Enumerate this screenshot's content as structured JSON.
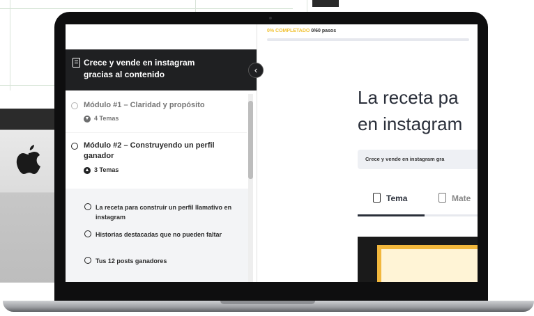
{
  "course": {
    "title": "Crece y vende en instagram gracias al contenido"
  },
  "progress": {
    "percent_label": "0% COMPLETADO",
    "steps_label": "0/60 pasos",
    "value": 0
  },
  "modules": [
    {
      "title": "Módulo #1 – Claridad y propósito",
      "topics": "4 Temas"
    },
    {
      "title": "Módulo #2 – Construyendo un perfil ganador",
      "topics": "3 Temas"
    }
  ],
  "lessons": [
    {
      "title": "La receta para construir un perfil llamativo en instagram"
    },
    {
      "title": "Historias destacadas que no pueden faltar"
    },
    {
      "title": "Tus 12 posts ganadores"
    }
  ],
  "main": {
    "heading_line1": "La receta pa",
    "heading_line2": "en instagram",
    "breadcrumb": "Crece y vende en instagram gra",
    "tab_topic": "Tema",
    "tab_materials": "Mate"
  },
  "colors": {
    "accent": "#f1c232",
    "sidebar_header": "#1f2022"
  }
}
